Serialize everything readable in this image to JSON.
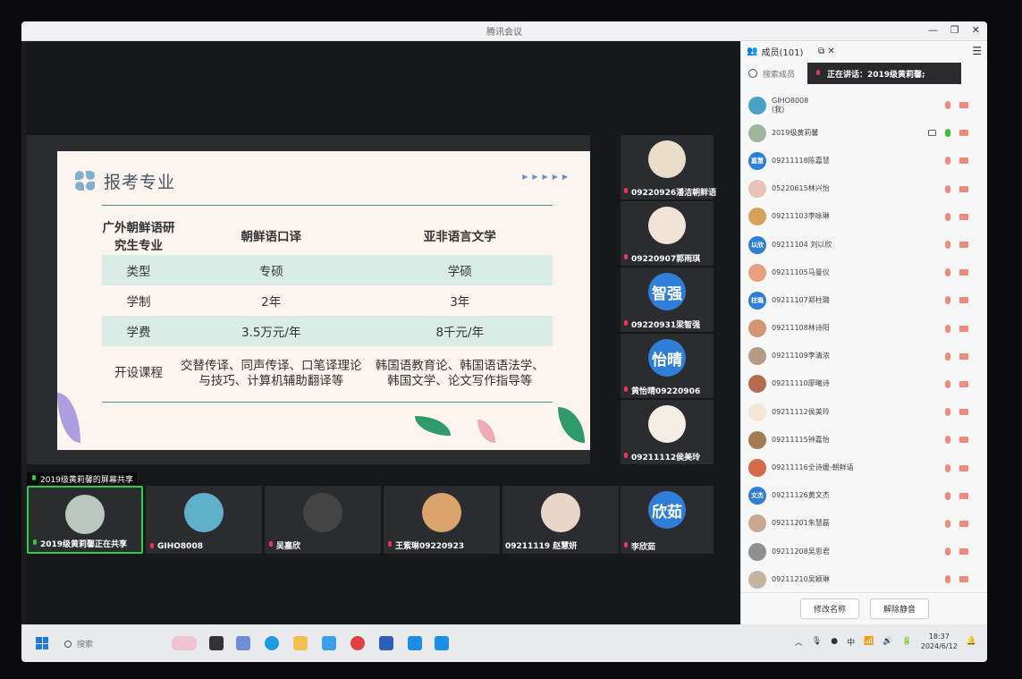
{
  "window": {
    "title": "腾讯会议"
  },
  "slide": {
    "title": "报考专业",
    "headers": [
      "广外朝鲜语研究生专业",
      "朝鲜语口译",
      "亚非语言文学"
    ],
    "rows": [
      [
        "类型",
        "专硕",
        "学硕"
      ],
      [
        "学制",
        "2年",
        "3年"
      ],
      [
        "学费",
        "3.5万元/年",
        "8千元/年"
      ],
      [
        "开设课程",
        "交替传译、同声传译、口笔译理论与技巧、计算机辅助翻译等",
        "韩国语教育论、韩国语语法学、韩国文学、论文写作指导等"
      ]
    ]
  },
  "share_label": "2019级黄莉馨的屏幕共享",
  "side_thumbs": [
    {
      "name": "09220926潘洁朝鲜语",
      "avatar_text": "",
      "color": "#e9dcc8"
    },
    {
      "name": "09220907郭雨琪",
      "avatar_text": "",
      "color": "#f1e3d8"
    },
    {
      "name": "09220931梁智强",
      "avatar_text": "智强",
      "color": "#2f7ed8"
    },
    {
      "name": "黄怡晴09220906",
      "avatar_text": "怡晴",
      "color": "#2f7ed8"
    },
    {
      "name": "09211112侯美玲",
      "avatar_text": "",
      "color": "#f5eee4"
    },
    {
      "name": "李欣茹",
      "avatar_text": "欣茹",
      "color": "#2f7ed8"
    }
  ],
  "bottom_thumbs": [
    {
      "name": "2019级黄莉馨正在共享",
      "color": "#b9c7be"
    },
    {
      "name": "GIHO8008",
      "color": "#5fb0c8"
    },
    {
      "name": "吴嘉欣",
      "color": "#444"
    },
    {
      "name": "王紫琳09220923",
      "color": "#d9a56c"
    },
    {
      "name": "09211119 赵慧妍",
      "color": "#e8d6c8"
    }
  ],
  "panel": {
    "title": "成员(101)",
    "search_placeholder": "搜索成员",
    "speaking": "正在讲话：2019级黄莉馨;",
    "members": [
      {
        "name": "GIHO8008\n(我)",
        "color": "#4aa3c7",
        "avatar_text": ""
      },
      {
        "name": "2019级黄莉馨",
        "color": "#9fb59e",
        "avatar_text": ""
      },
      {
        "name": "09211118陈嘉慧",
        "color": "#2f7ed8",
        "avatar_text": "嘉慧"
      },
      {
        "name": "05220615林兴怡",
        "color": "#e8c3b6",
        "avatar_text": ""
      },
      {
        "name": "09211103李咏琳",
        "color": "#d5a45a",
        "avatar_text": ""
      },
      {
        "name": "09211104 刘以欣",
        "color": "#2f7ed8",
        "avatar_text": "以欣"
      },
      {
        "name": "09211105马曼仪",
        "color": "#e9a07d",
        "avatar_text": ""
      },
      {
        "name": "09211107郑柱璐",
        "color": "#2f7ed8",
        "avatar_text": "柱璐"
      },
      {
        "name": "09211108林诗阳",
        "color": "#d09770",
        "avatar_text": ""
      },
      {
        "name": "09211109李清浓",
        "color": "#b49b85",
        "avatar_text": ""
      },
      {
        "name": "09211110廖曦诗",
        "color": "#b56b4e",
        "avatar_text": ""
      },
      {
        "name": "09211112侯美玲",
        "color": "#f2e7d6",
        "avatar_text": ""
      },
      {
        "name": "09211115钟嘉怡",
        "color": "#a37d52",
        "avatar_text": ""
      },
      {
        "name": "09211116全诗媛-朝鲜语",
        "color": "#d46a4a",
        "avatar_text": ""
      },
      {
        "name": "09211126黄文杰",
        "color": "#2f7ed8",
        "avatar_text": "文杰"
      },
      {
        "name": "09211201朱慧磊",
        "color": "#c9a890",
        "avatar_text": ""
      },
      {
        "name": "09211208吴思君",
        "color": "#8f8f8f",
        "avatar_text": ""
      },
      {
        "name": "09211210吴颖琳",
        "color": "#c7b3a0",
        "avatar_text": ""
      }
    ],
    "rename_label": "修改名称",
    "unmute_label": "解除静音"
  },
  "taskbar": {
    "search_placeholder": "搜索",
    "time": "18:37",
    "date": "2024/6/12",
    "ime": "中"
  }
}
